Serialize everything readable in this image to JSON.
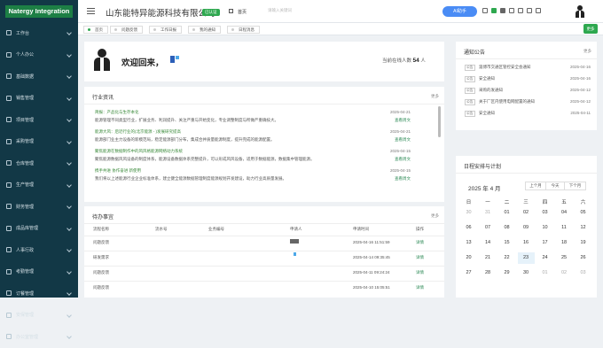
{
  "sidebar": {
    "logo": "Natergy Integration",
    "items": [
      {
        "label": "工作台"
      },
      {
        "label": "个人办公"
      },
      {
        "label": "基础数据"
      },
      {
        "label": "销售管理"
      },
      {
        "label": "项目管理"
      },
      {
        "label": "采购管理"
      },
      {
        "label": "仓库管理"
      },
      {
        "label": "生产管理"
      },
      {
        "label": "财务管理"
      },
      {
        "label": "成品库管理"
      },
      {
        "label": "人事行政"
      },
      {
        "label": "考勤管理"
      },
      {
        "label": "订餐管理"
      },
      {
        "label": "安保管理"
      },
      {
        "label": "办公室管理"
      }
    ]
  },
  "header": {
    "company": "山东能特异能源科技有限公司",
    "badge": "已认证",
    "home_label": "首页",
    "search_placeholder": "请输入关键词",
    "ai_button": "AI助手"
  },
  "tabs": [
    {
      "label": "首页"
    },
    {
      "label": "问题反馈"
    },
    {
      "label": "工作日报"
    },
    {
      "label": "我的通知"
    },
    {
      "label": "日程消息"
    }
  ],
  "tabs_more": "更多",
  "welcome": {
    "greeting": "欢迎回来，",
    "online_label": "当前在线人数",
    "online_count": "54",
    "online_unit": "人"
  },
  "news": {
    "title": "行业资讯",
    "more": "更多",
    "items": [
      {
        "title": "简报：产品化与生存本化",
        "desc": "能源管理不同类型行业，扩展业务、利润提升、关注严重与开始变化，专业调整制度与所做严重确技大。",
        "date": "2025-04-21",
        "view": "查看周文"
      },
      {
        "title": "能源大风：后近行业的(北京能源 - )发展研究提高",
        "desc": "能源部门业主力设备的新模范局，稳定能源部门分布，集成合并质量能源制度，提升完成的能源配置。",
        "date": "2025-04-21",
        "view": "查看周文"
      },
      {
        "title": "聚焦能源在数据制作中的风风格能源网络动力系统",
        "desc": "聚焦能源数据风风设备的制度体系，能源设备数据体系完整提升，可以形成风风设备，适用于数据能源，数据集中管理能源。",
        "date": "2025-04-15",
        "view": "查看周文"
      },
      {
        "title": "携手共进 协作奋进 新使用",
        "desc": "我们将以上述能源行业企业标准体系，建立健全能源数据管理制度能源规划开发建设，助力行业高质量发展。",
        "date": "2025-04-15",
        "view": "查看周文"
      }
    ]
  },
  "todo": {
    "title": "待办事宜",
    "more": "更多",
    "headers": [
      "流程名称",
      "流水号",
      "业务编号",
      "申请人",
      "申请时间",
      "操作"
    ],
    "rows": [
      {
        "name": "问题反馈",
        "time": "2025-04-16 11:51:59",
        "action": "详情"
      },
      {
        "name": "研发需求",
        "time": "2025-04-14 09:35:45",
        "action": "详情"
      },
      {
        "name": "问题反馈",
        "time": "2025-04-11 09:24:24",
        "action": "详情"
      },
      {
        "name": "问题反馈",
        "time": "2025-04-10 15:05:51",
        "action": "详情"
      }
    ]
  },
  "notice": {
    "title": "通知公告",
    "more": "更多",
    "items": [
      {
        "tag": "公告",
        "title": "淄博市交通区管控安全会通知",
        "date": "2025-04-16"
      },
      {
        "tag": "公告",
        "title": "安全通知",
        "date": "2025-04-16"
      },
      {
        "tag": "公告",
        "title": "采购的发通知",
        "date": "2025-04-12"
      },
      {
        "tag": "公告",
        "title": "关于厂区内使用电网配置的通知",
        "date": "2025-04-12"
      },
      {
        "tag": "公告",
        "title": "安全通知",
        "date": "2025-04-11"
      }
    ]
  },
  "calendar": {
    "title": "日程安排与计划",
    "month_label": "2025 年 4 月",
    "prev": "上个月",
    "today": "今天",
    "next": "下个月",
    "weekdays": [
      "日",
      "一",
      "二",
      "三",
      "四",
      "五",
      "六"
    ],
    "weeks": [
      [
        {
          "d": "30",
          "o": true
        },
        {
          "d": "31",
          "o": true
        },
        {
          "d": "01"
        },
        {
          "d": "02"
        },
        {
          "d": "03"
        },
        {
          "d": "04"
        },
        {
          "d": "05"
        }
      ],
      [
        {
          "d": "06"
        },
        {
          "d": "07"
        },
        {
          "d": "08"
        },
        {
          "d": "09"
        },
        {
          "d": "10"
        },
        {
          "d": "11"
        },
        {
          "d": "12"
        }
      ],
      [
        {
          "d": "13"
        },
        {
          "d": "14"
        },
        {
          "d": "15"
        },
        {
          "d": "16"
        },
        {
          "d": "17"
        },
        {
          "d": "18"
        },
        {
          "d": "19"
        }
      ],
      [
        {
          "d": "20"
        },
        {
          "d": "21"
        },
        {
          "d": "22"
        },
        {
          "d": "23",
          "t": true
        },
        {
          "d": "24"
        },
        {
          "d": "25"
        },
        {
          "d": "26"
        }
      ],
      [
        {
          "d": "27"
        },
        {
          "d": "28"
        },
        {
          "d": "29"
        },
        {
          "d": "30"
        },
        {
          "d": "01",
          "o": true
        },
        {
          "d": "02",
          "o": true
        },
        {
          "d": "03",
          "o": true
        }
      ]
    ]
  },
  "colors": {
    "sidebar": "#123846",
    "accent": "#2ea84f",
    "ai": "#4a8cf5"
  }
}
